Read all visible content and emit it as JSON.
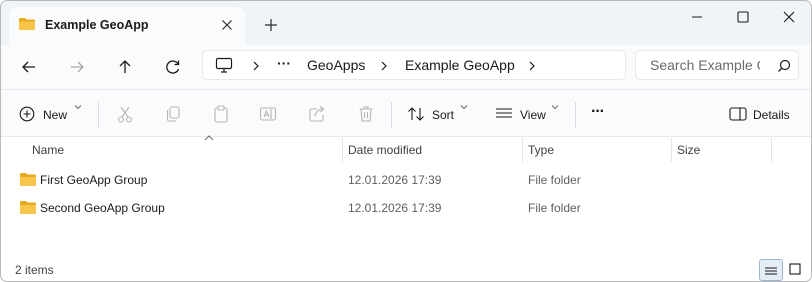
{
  "window": {
    "tab_title": "Example GeoApp",
    "tab_icon": "folder-icon",
    "controls": [
      "minimize-icon",
      "maximize-icon",
      "close-icon"
    ]
  },
  "address": {
    "breadcrumbs": [
      "GeoApps",
      "Example GeoApp"
    ],
    "overflow": "···",
    "search_placeholder": "Search Example G"
  },
  "commands": {
    "new_label": "New",
    "sort_label": "Sort",
    "view_label": "View",
    "more_label": "···",
    "details_label": "Details"
  },
  "columns": {
    "name": "Name",
    "date_modified": "Date modified",
    "type": "Type",
    "size": "Size"
  },
  "files": [
    {
      "name": "First GeoApp Group",
      "date_modified": "12.01.2026 17:39",
      "type": "File folder",
      "size": ""
    },
    {
      "name": "Second GeoApp Group",
      "date_modified": "12.01.2026 17:39",
      "type": "File folder",
      "size": ""
    }
  ],
  "status": {
    "item_count": "2 items"
  },
  "colors": {
    "folder": "#f4c03f",
    "titlebar": "#eff4f9",
    "accent": "#0067c0"
  }
}
